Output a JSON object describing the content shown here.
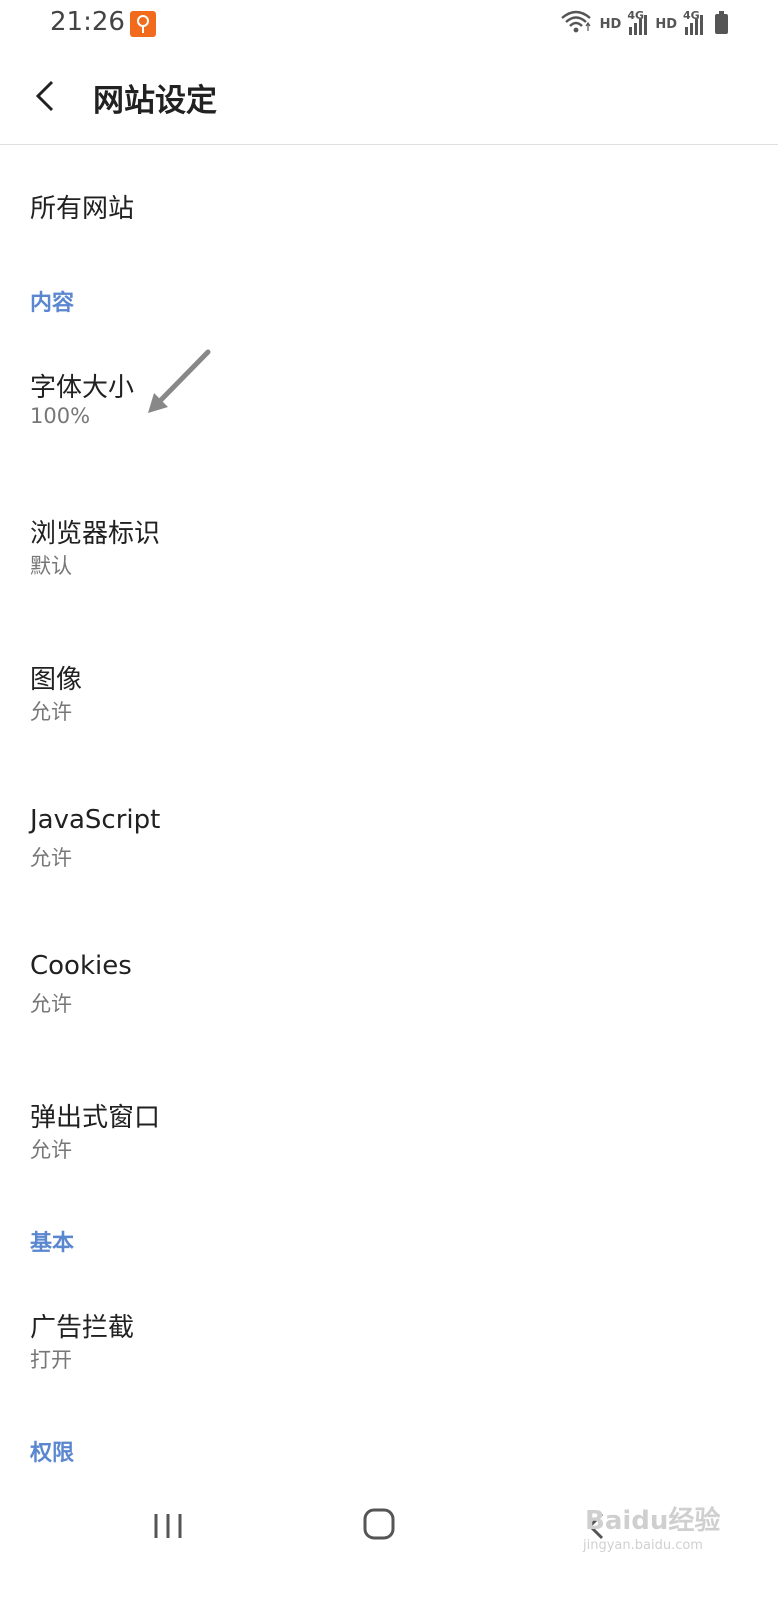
{
  "status_bar": {
    "time": "21:26",
    "hd1": "HD",
    "net1": "4G",
    "hd2": "HD",
    "net2": "4G",
    "icons": [
      "wifi-icon",
      "signal-icon",
      "battery-icon"
    ]
  },
  "app_bar": {
    "title": "网站设定",
    "back_icon": "chevron-left-icon"
  },
  "list": {
    "all_sites": "所有网站",
    "section_content": "内容",
    "font_size": {
      "title": "字体大小",
      "value": "100%"
    },
    "user_agent": {
      "title": "浏览器标识",
      "value": "默认"
    },
    "images": {
      "title": "图像",
      "value": "允许"
    },
    "javascript": {
      "title": "JavaScript",
      "value": "允许"
    },
    "cookies": {
      "title": "Cookies",
      "value": "允许"
    },
    "popups": {
      "title": "弹出式窗口",
      "value": "允许"
    },
    "section_basic": "基本",
    "ad_block": {
      "title": "广告拦截",
      "value": "打开"
    },
    "section_permissions": "权限"
  },
  "nav_bar": {
    "icons": [
      "recent-apps-icon",
      "home-icon",
      "back-icon"
    ]
  },
  "watermark": {
    "text": "Baidu经验",
    "sub": "jingyan.baidu.com"
  },
  "colors": {
    "section_accent": "#5a87cf",
    "notification_badge": "#f26b1d"
  }
}
